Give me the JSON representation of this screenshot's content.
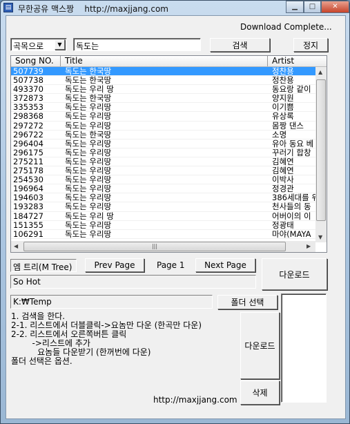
{
  "window": {
    "title": "무한공유 맥스짱",
    "title_url": "http://maxjjang.com",
    "controls": {
      "minimize": "minimize-icon",
      "maximize": "maximize-icon",
      "close": "close-icon"
    }
  },
  "status": "Download Complete...",
  "search": {
    "mode": "곡목으로",
    "query": "독도는",
    "search_label": "검색",
    "stop_label": "정지"
  },
  "list": {
    "columns": [
      "Song NO.",
      "Title",
      "Artist"
    ],
    "selected_index": 0,
    "rows": [
      [
        "507739",
        "독도는 한국땅",
        "정찬용"
      ],
      [
        "507738",
        "독도는 한국땅",
        "정찬용"
      ],
      [
        "493370",
        "독도는 우리 땅",
        "동요랑 같이"
      ],
      [
        "372873",
        "독도는 한국땅",
        "양지원"
      ],
      [
        "335353",
        "독도는 우리땅",
        "이기쁨"
      ],
      [
        "298368",
        "독도는 우리땅",
        "유상록"
      ],
      [
        "297272",
        "독도는 우리땅",
        "몸짱 댄스"
      ],
      [
        "296722",
        "독도는 한국땅",
        "소명"
      ],
      [
        "296404",
        "독도는 우리땅",
        "유아 동요 베"
      ],
      [
        "296175",
        "독도는 우리땅",
        "꾸러기 합창"
      ],
      [
        "275211",
        "독도는 우리땅",
        "김혜연"
      ],
      [
        "275178",
        "독도는 우리땅",
        "김혜연"
      ],
      [
        "254530",
        "독도는 우리땅",
        "이박사"
      ],
      [
        "196964",
        "독도는 우리땅",
        "정경관"
      ],
      [
        "194603",
        "독도는 우리땅",
        "386세대를 위"
      ],
      [
        "193283",
        "독도는 우리땅",
        "천사들의 동"
      ],
      [
        "184727",
        "독도는 우리 땅",
        "어버이의 이"
      ],
      [
        "151355",
        "독도는 우리땅",
        "정광태"
      ],
      [
        "106291",
        "독도는 우리땅",
        "마야(MAYA"
      ]
    ]
  },
  "paging": {
    "album": "엠 트리(M Tree)",
    "prev_label": "Prev Page",
    "page": "Page 1",
    "next_label": "Next Page",
    "download_label": "다운로드",
    "selected_title": "So Hot"
  },
  "folder": {
    "path": "K:₩Temp",
    "select_label": "폴더 선택"
  },
  "help_lines": [
    "1. 검색을 한다.",
    "2-1. 리스트에서 더블클릭->요놈만 다운 (한곡만 다운)",
    "2-2. 리스트에서 오른쪽버튼 클릭",
    "        ->리스트에 추가",
    "          요놈들 다운받기 (한꺼번에 다운)",
    "폴더 선택은 옵션."
  ],
  "queue": {
    "download_label": "다운로드",
    "delete_label": "삭제"
  },
  "footer_url": "http://maxjjang.com"
}
